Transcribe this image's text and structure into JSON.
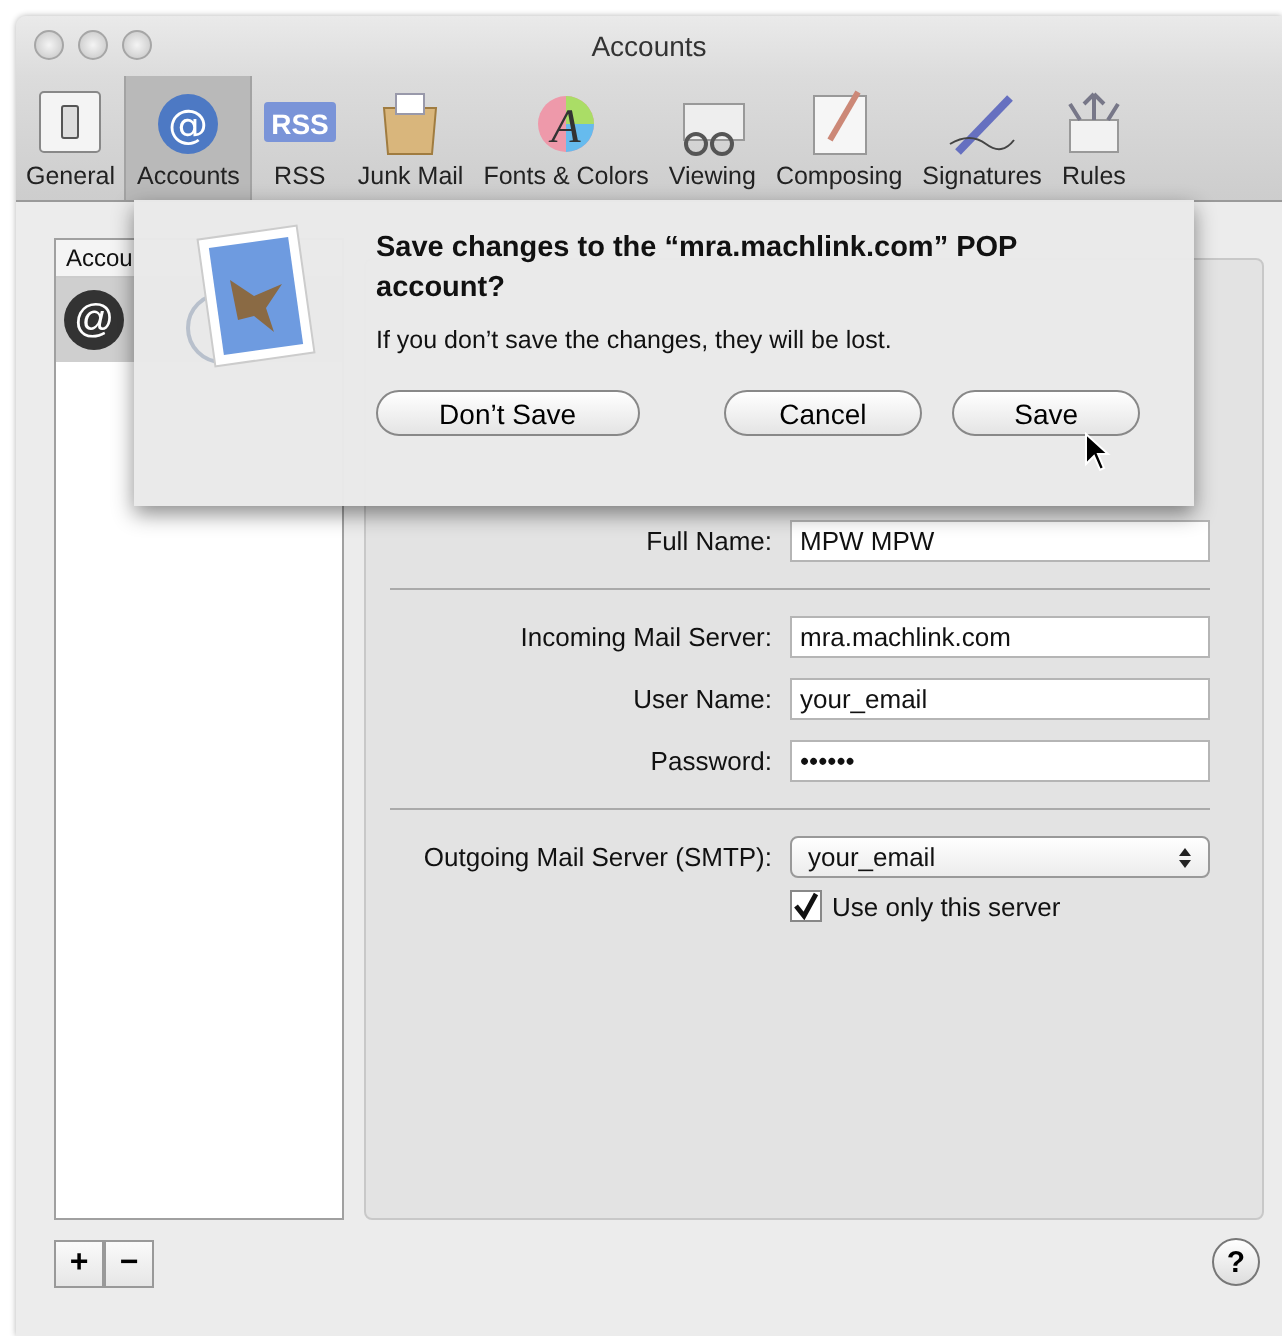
{
  "window": {
    "title": "Accounts"
  },
  "toolbar": [
    {
      "label": "General",
      "selected": false
    },
    {
      "label": "Accounts",
      "selected": true,
      "glyph": "@"
    },
    {
      "label": "RSS",
      "selected": false,
      "badge": "RSS"
    },
    {
      "label": "Junk Mail",
      "selected": false
    },
    {
      "label": "Fonts & Colors",
      "selected": false,
      "glyph": "A"
    },
    {
      "label": "Viewing",
      "selected": false
    },
    {
      "label": "Composing",
      "selected": false
    },
    {
      "label": "Signatures",
      "selected": false
    },
    {
      "label": "Rules",
      "selected": false
    }
  ],
  "accounts_list": {
    "header": "Accou",
    "rows": [
      {
        "glyph": "@",
        "selected": true
      }
    ]
  },
  "dialog": {
    "title": "Save changes to the “mra.machlink.com” POP account?",
    "message": "If you don’t save the changes, they will be lost.",
    "buttons": [
      {
        "label": "Don’t Save",
        "kind": "secondary"
      },
      {
        "label": "Cancel",
        "kind": "cancel"
      },
      {
        "label": "Save",
        "kind": "default"
      }
    ]
  },
  "field_groups": [
    [
      {
        "label": "Full Name:",
        "value": "MPW MPW"
      }
    ],
    [
      {
        "label": "Incoming Mail Server:",
        "value": "mra.machlink.com"
      },
      {
        "label": "User Name:",
        "value": "your_email"
      },
      {
        "label": "Password:",
        "value": "••••••"
      }
    ]
  ],
  "smtp": {
    "label": "Outgoing Mail Server (SMTP):",
    "value": "your_email"
  },
  "use_only_server": {
    "label": "Use only this server",
    "checked": true
  },
  "list_buttons": [
    "+",
    "−"
  ],
  "help": "?"
}
